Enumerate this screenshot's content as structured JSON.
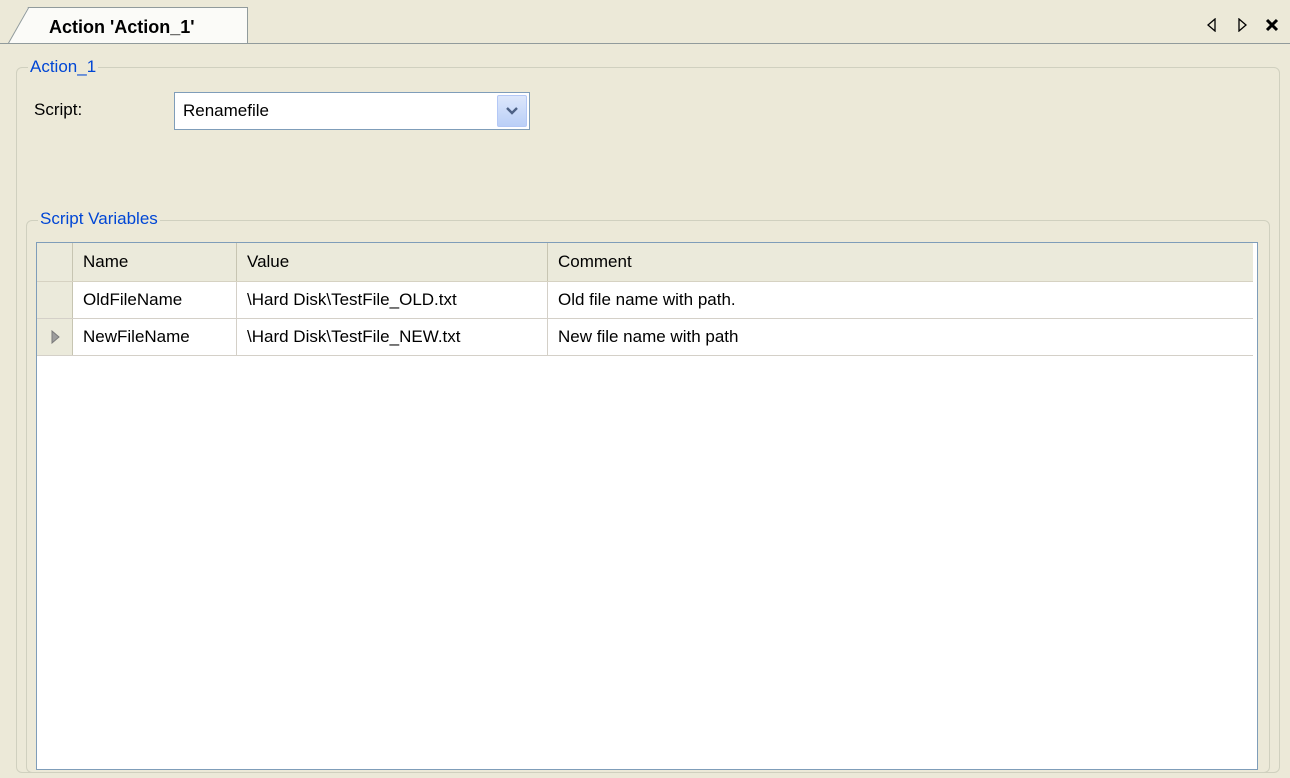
{
  "tab": {
    "title": "Action 'Action_1'"
  },
  "tab_controls": {
    "prev_icon": "triangle-left-icon",
    "next_icon": "triangle-right-icon",
    "close_icon": "close-icon"
  },
  "action_group": {
    "legend": "Action_1",
    "script_label": "Script:",
    "script_value": "Renamefile"
  },
  "variables_group": {
    "legend": "Script Variables",
    "columns": [
      "Name",
      "Value",
      "Comment"
    ],
    "rows": [
      {
        "name": "OldFileName",
        "value": "\\Hard Disk\\TestFile_OLD.txt",
        "comment": "Old file name with path.",
        "current": false
      },
      {
        "name": "NewFileName",
        "value": "\\Hard Disk\\TestFile_NEW.txt",
        "comment": "New file name with path",
        "current": true
      }
    ]
  },
  "colors": {
    "group_legend": "#0046d5",
    "window_bg": "#ece9d8"
  }
}
